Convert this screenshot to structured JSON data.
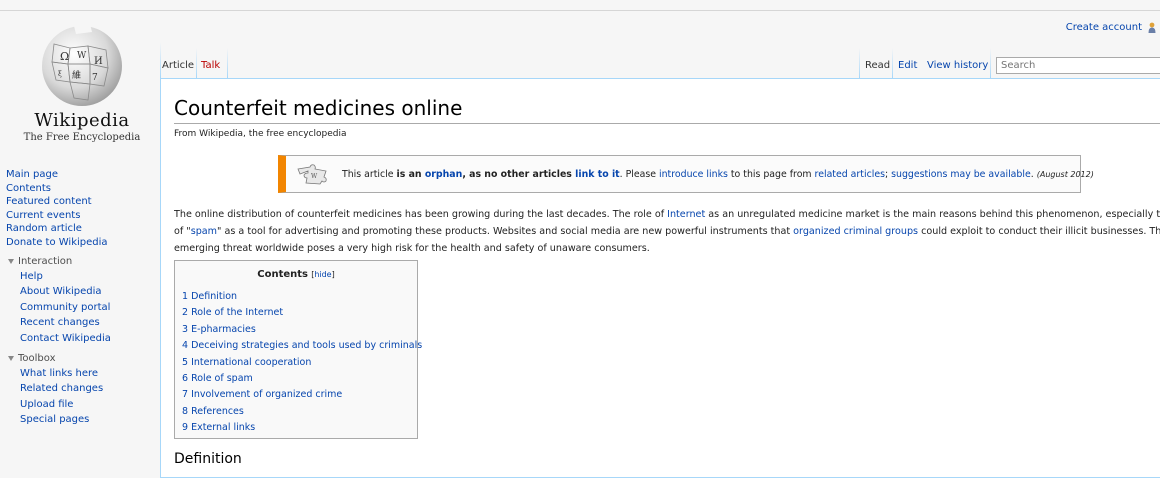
{
  "personal": {
    "create_account": "Create account"
  },
  "logo": {
    "title": "Wikipedia",
    "subtitle": "The Free Encyclopedia"
  },
  "sidebar": {
    "main": [
      "Main page",
      "Contents",
      "Featured content",
      "Current events",
      "Random article",
      "Donate to Wikipedia"
    ],
    "interaction": {
      "heading": "Interaction",
      "items": [
        "Help",
        "About Wikipedia",
        "Community portal",
        "Recent changes",
        "Contact Wikipedia"
      ]
    },
    "toolbox": {
      "heading": "Toolbox",
      "items": [
        "What links here",
        "Related changes",
        "Upload file",
        "Special pages"
      ]
    }
  },
  "tabs": {
    "article": "Article",
    "talk": "Talk",
    "read": "Read",
    "edit": "Edit",
    "history": "View history"
  },
  "search": {
    "placeholder": "Search"
  },
  "page": {
    "title": "Counterfeit medicines online",
    "site_sub": "From Wikipedia, the free encyclopedia"
  },
  "ambox": {
    "t1": "This article ",
    "b1": "is an ",
    "l1": "orphan",
    "b2": ", as no other articles ",
    "l2": "link to it",
    "t2": ". Please ",
    "l3": "introduce links",
    "t3": " to this page from ",
    "l4": "related articles",
    "t4": "; ",
    "l5": "suggestions may be available",
    "t5": ". ",
    "date": "(August 2012)"
  },
  "intro": {
    "p1a": "The online distribution of counterfeit medicines has been growing during the last decades. The role of ",
    "p1link": "Internet",
    "p1b": " as an unregulated medicine market is the main reasons behind this phenomenon, especially the effectiveness",
    "p2a": "of \"",
    "p2link1": "spam",
    "p2b": "\" as a tool for advertising and promoting these products. Websites and social media are new powerful instruments that ",
    "p2link2": "organized criminal groups",
    "p2c": " could exploit to conduct their illicit businesses. The spread of",
    "p3": "emerging threat worldwide poses a very high risk for the health and safety of unaware consumers."
  },
  "toc": {
    "title": "Contents",
    "hide": "hide",
    "items": [
      "1 Definition",
      "2 Role of the Internet",
      "3 E-pharmacies",
      "4 Deceiving strategies and tools used by criminals",
      "5 International cooperation",
      "6 Role of spam",
      "7 Involvement of organized crime",
      "8 References",
      "9 External links"
    ]
  },
  "sections": {
    "definition": "Definition"
  }
}
